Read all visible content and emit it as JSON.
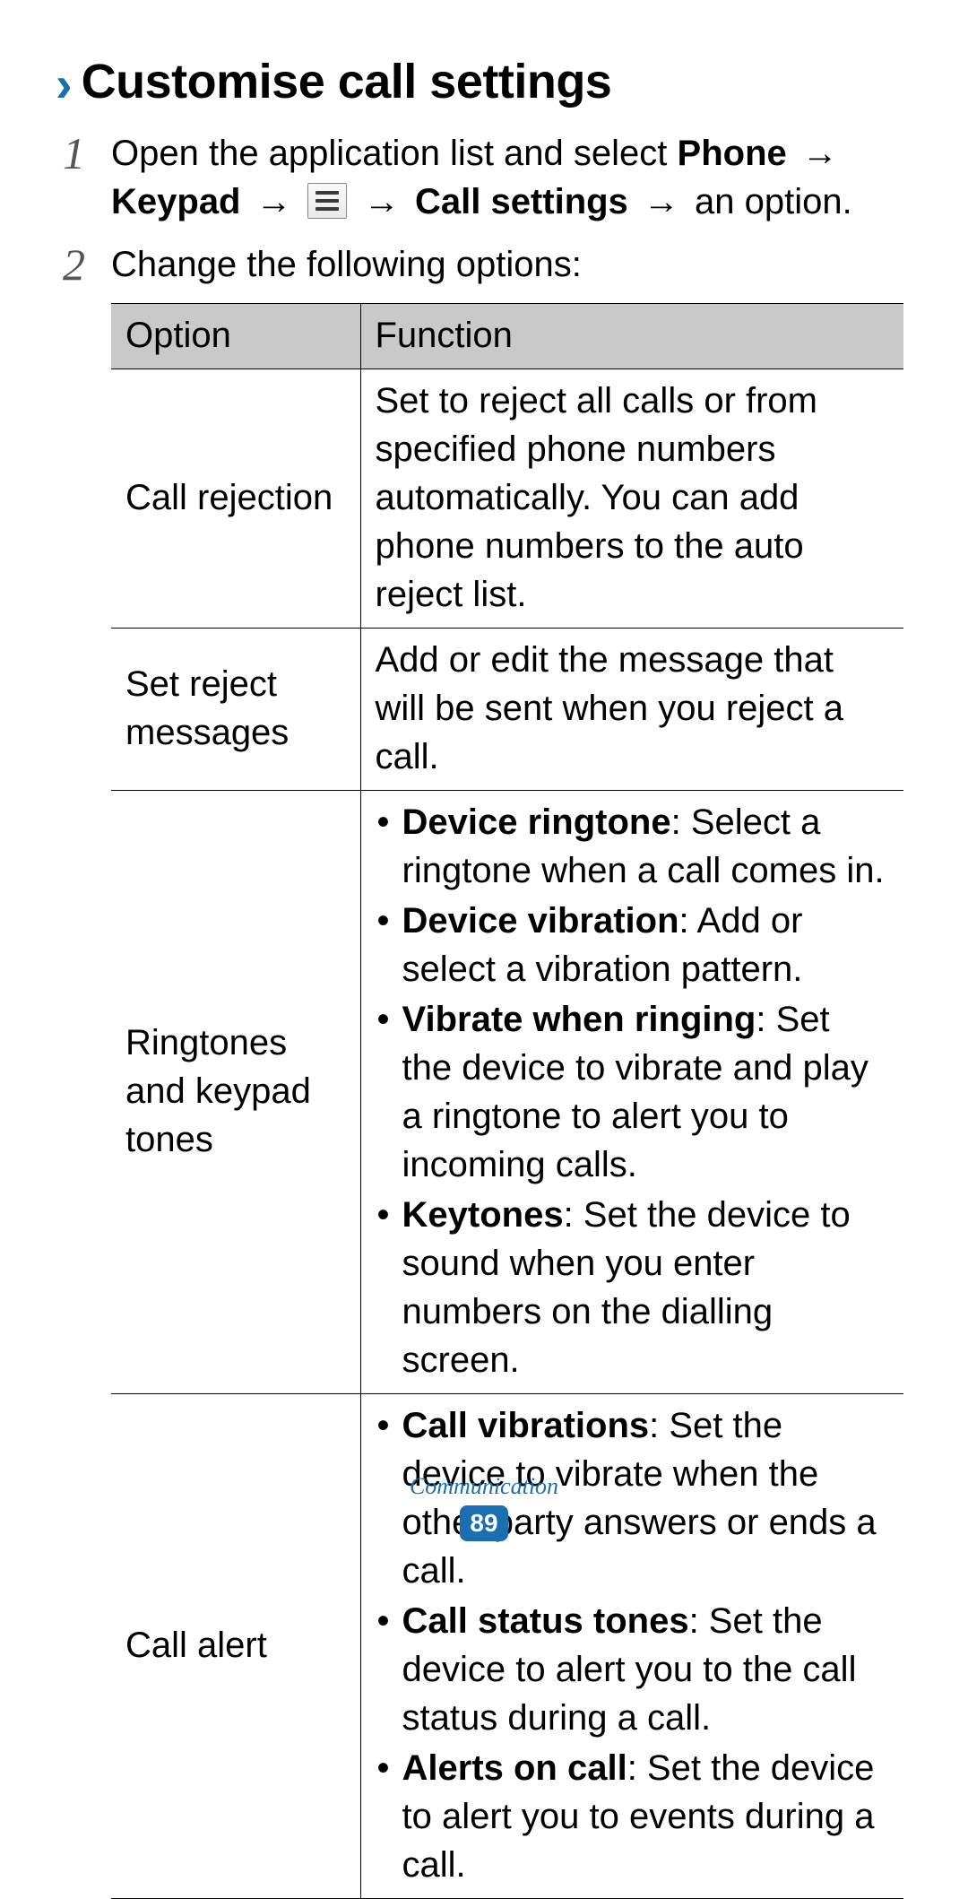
{
  "heading": {
    "chevron": "›",
    "title": "Customise call settings"
  },
  "steps": {
    "s1": {
      "num": "1",
      "pre": "Open the application list and select ",
      "b1": "Phone",
      "arr1": " → ",
      "b2": "Keypad",
      "arr2": " → ",
      "arr3": " → ",
      "b3": "Call settings",
      "arr4": " → ",
      "post": "an option."
    },
    "s2": {
      "num": "2",
      "text": "Change the following options:"
    }
  },
  "table": {
    "head": {
      "option": "Option",
      "function": "Function"
    },
    "rows": {
      "r0": {
        "option": "Call rejection",
        "func_text": "Set to reject all calls or from specified phone numbers automatically. You can add phone numbers to the auto reject list."
      },
      "r1": {
        "option": "Set reject messages",
        "func_text": "Add or edit the message that will be sent when you reject a call."
      },
      "r2": {
        "option": "Ringtones and keypad tones",
        "bullets": {
          "b0": {
            "bold": "Device ringtone",
            "rest": ": Select a ringtone when a call comes in."
          },
          "b1": {
            "bold": "Device vibration",
            "rest": ": Add or select a vibration pattern."
          },
          "b2": {
            "bold": "Vibrate when ringing",
            "rest": ": Set the device to vibrate and play a ringtone to alert you to incoming calls."
          },
          "b3": {
            "bold": "Keytones",
            "rest": ": Set the device to sound when you enter numbers on the dialling screen."
          }
        }
      },
      "r3": {
        "option": "Call alert",
        "bullets": {
          "b0": {
            "bold": "Call vibrations",
            "rest": ": Set the device to vibrate when the other party answers or ends a call."
          },
          "b1": {
            "bold": "Call status tones",
            "rest": ": Set the device to alert you to the call status during a call."
          },
          "b2": {
            "bold": "Alerts on call",
            "rest": ": Set the device to alert you to events during a call."
          }
        }
      }
    }
  },
  "footer": {
    "section": "Communication",
    "page": "89"
  }
}
